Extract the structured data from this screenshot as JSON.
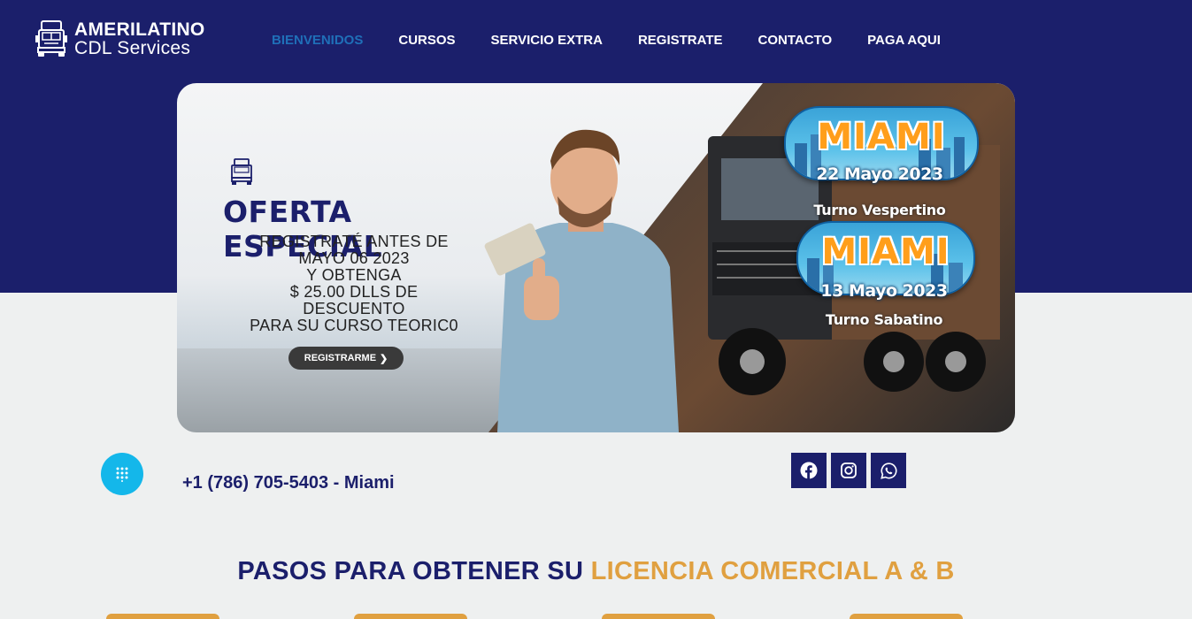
{
  "brand": {
    "name_line1": "AMERILATINO",
    "name_line2": "CDL Services"
  },
  "nav": {
    "items": [
      {
        "label": "BIENVENIDOS",
        "active": true
      },
      {
        "label": "CURSOS"
      },
      {
        "label": "SERVICIO EXTRA"
      },
      {
        "label": "REGISTRATE"
      },
      {
        "label": "CONTACTO"
      },
      {
        "label": "PAGA AQUI"
      }
    ]
  },
  "banner": {
    "promo_title": "OFERTA ESPECIAL",
    "promo_lines": [
      "REGISTRATÉ ANTES DE",
      "MAYO 06 2023",
      "Y OBTENGA",
      "$ 25.00 DLLS DE",
      "DESCUENTO",
      "PARA SU CURSO TEORIC0"
    ],
    "cta_label": "REGISTRARME",
    "sessions": [
      {
        "city": "MIAMI",
        "date": "22 Mayo 2023",
        "turn": "Turno Vespertino"
      },
      {
        "city": "MIAMI",
        "date": "13 Mayo 2023",
        "turn": "Turno Sabatino"
      }
    ]
  },
  "contact": {
    "phone": "+1 (786) 705-5403 - Miami"
  },
  "social": [
    "facebook-icon",
    "instagram-icon",
    "whatsapp-icon"
  ],
  "steps": {
    "title_part1": "PASOS PARA OBTENER SU ",
    "title_part2": "LICENCIA COMERCIAL A & B"
  },
  "colors": {
    "navy": "#1b1f6b",
    "accent": "#e0a040",
    "nav_active": "#1f6fb8",
    "dial": "#14b7ea"
  }
}
